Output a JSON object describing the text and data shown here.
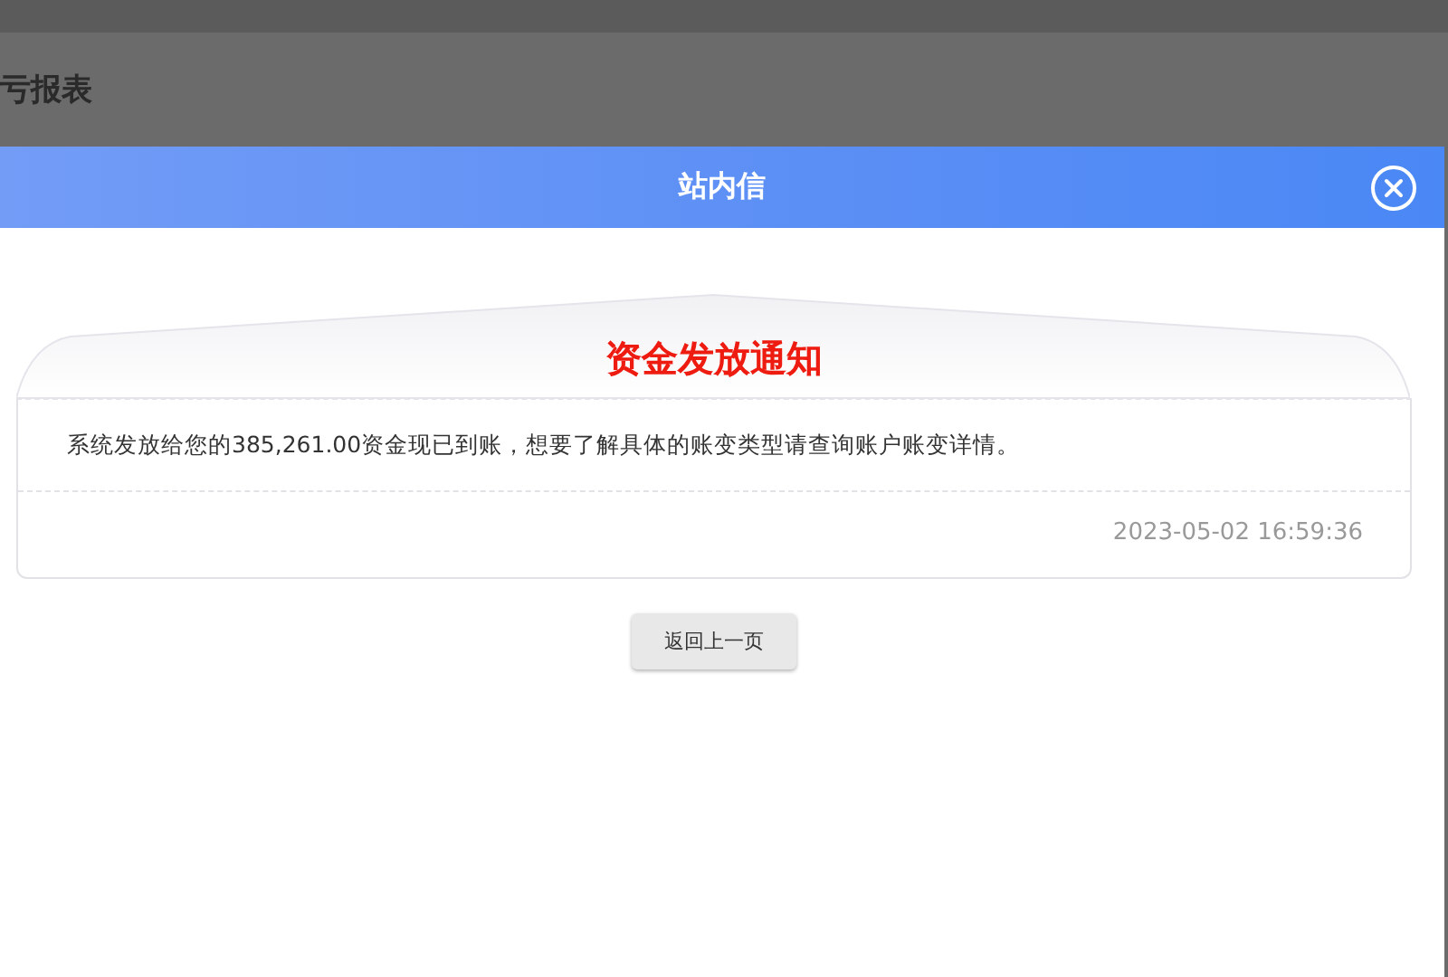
{
  "page": {
    "title": "亏报表"
  },
  "dialog": {
    "title": "站内信"
  },
  "notice": {
    "heading": "资金发放通知",
    "message": "系统发放给您的385,261.00资金现已到账，想要了解具体的账变类型请查询账户账变详情。",
    "time": "2023-05-02 16:59:36"
  },
  "buttons": [
    "返回上一页"
  ]
}
